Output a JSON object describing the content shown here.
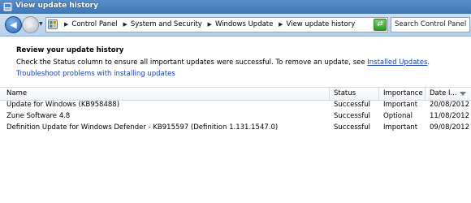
{
  "window": {
    "title": "View update history"
  },
  "address": {
    "crumbs": [
      "Control Panel",
      "System and Security",
      "Windows Update",
      "View update history"
    ],
    "search_placeholder": "Search Control Panel"
  },
  "content": {
    "heading": "Review your update history",
    "instruction": "Check the Status column to ensure all important updates were successful. To remove an update, see ",
    "installed_updates_link": "Installed Updates",
    "instruction_end": ".",
    "troubleshoot_link": "Troubleshoot problems with installing updates"
  },
  "table": {
    "columns": {
      "name": "Name",
      "status": "Status",
      "importance": "Importance",
      "date": "Date I..."
    },
    "rows": [
      {
        "name": "Update for Windows (KB958488)",
        "status": "Successful",
        "importance": "Important",
        "date": "20/08/2012"
      },
      {
        "name": "Zune Software 4.8",
        "status": "Successful",
        "importance": "Optional",
        "date": "11/08/2012"
      },
      {
        "name": "Definition Update for Windows Defender - KB915597 (Definition 1.131.1547.0)",
        "status": "Successful",
        "importance": "Important",
        "date": "09/08/2012"
      }
    ]
  }
}
